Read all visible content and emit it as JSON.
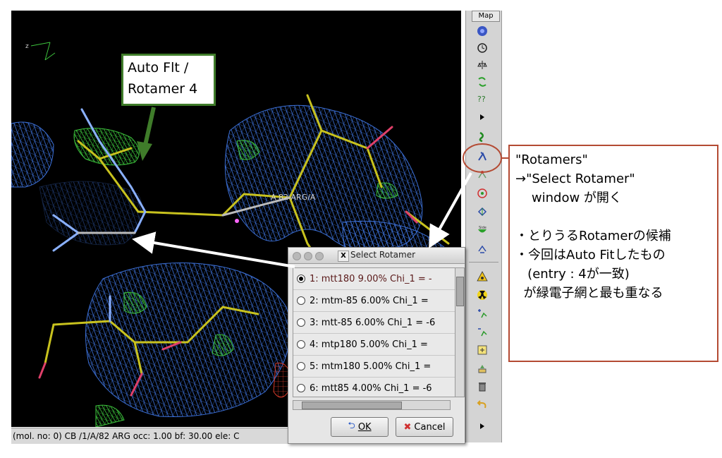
{
  "viewer": {
    "residue_label": "A 82 ARG/A",
    "axis_label": "z"
  },
  "status_bar": {
    "text": "(mol. no: 0)  CB /1/A/82 ARG occ:  1.00 bf: 30.00 ele:  C"
  },
  "toolbar": {
    "tab_label": "Map",
    "icons": [
      "globe-icon",
      "clock-icon",
      "balance-icon",
      "rotate-icon",
      "question-icon",
      "arrow-right-icon",
      "dna-icon",
      "rotamers-icon",
      "torsion-icon",
      "target-icon",
      "fit-icon",
      "bowl-icon",
      "jump-icon",
      "hazard-icon",
      "radiation-icon",
      "add-atom-icon",
      "delete-atom-icon",
      "box-icon",
      "stack-icon",
      "bin-icon",
      "undo-icon",
      "arrow-right-icon"
    ]
  },
  "dialog": {
    "title": "Select Rotamer",
    "rows": [
      {
        "label": "1:  mtt180   9.00% Chi_1 = -",
        "selected": true
      },
      {
        "label": "2:  mtm-85   6.00% Chi_1 =",
        "selected": false
      },
      {
        "label": "3:  mtt-85   6.00% Chi_1 = -6",
        "selected": false
      },
      {
        "label": "4:  mtp180   5.00% Chi_1 =",
        "selected": false
      },
      {
        "label": "5:  mtm180   5.00% Chi_1 =",
        "selected": false
      },
      {
        "label": "6:  mtt85   4.00% Chi_1 = -6",
        "selected": false
      }
    ],
    "ok_label": "OK",
    "cancel_label": "Cancel"
  },
  "callout_autofit": {
    "line1": "Auto Flt /",
    "line2": "Rotamer 4"
  },
  "callout_rotamers": {
    "lines": [
      "\"Rotamers\"",
      "→\"Select Rotamer\"",
      "    window が開く",
      "",
      "・とりうるRotamerの候補",
      "・今回はAuto Fitしたもの",
      "   (entry : 4が一致)",
      "  が緑電子網と最も重なる"
    ]
  },
  "colors": {
    "callout_green": "#3f7c2a",
    "callout_red": "#b44a33",
    "density_blue": "#3b6fd6",
    "density_green": "#3cc23c",
    "bond_yellow": "#c8c21e"
  }
}
